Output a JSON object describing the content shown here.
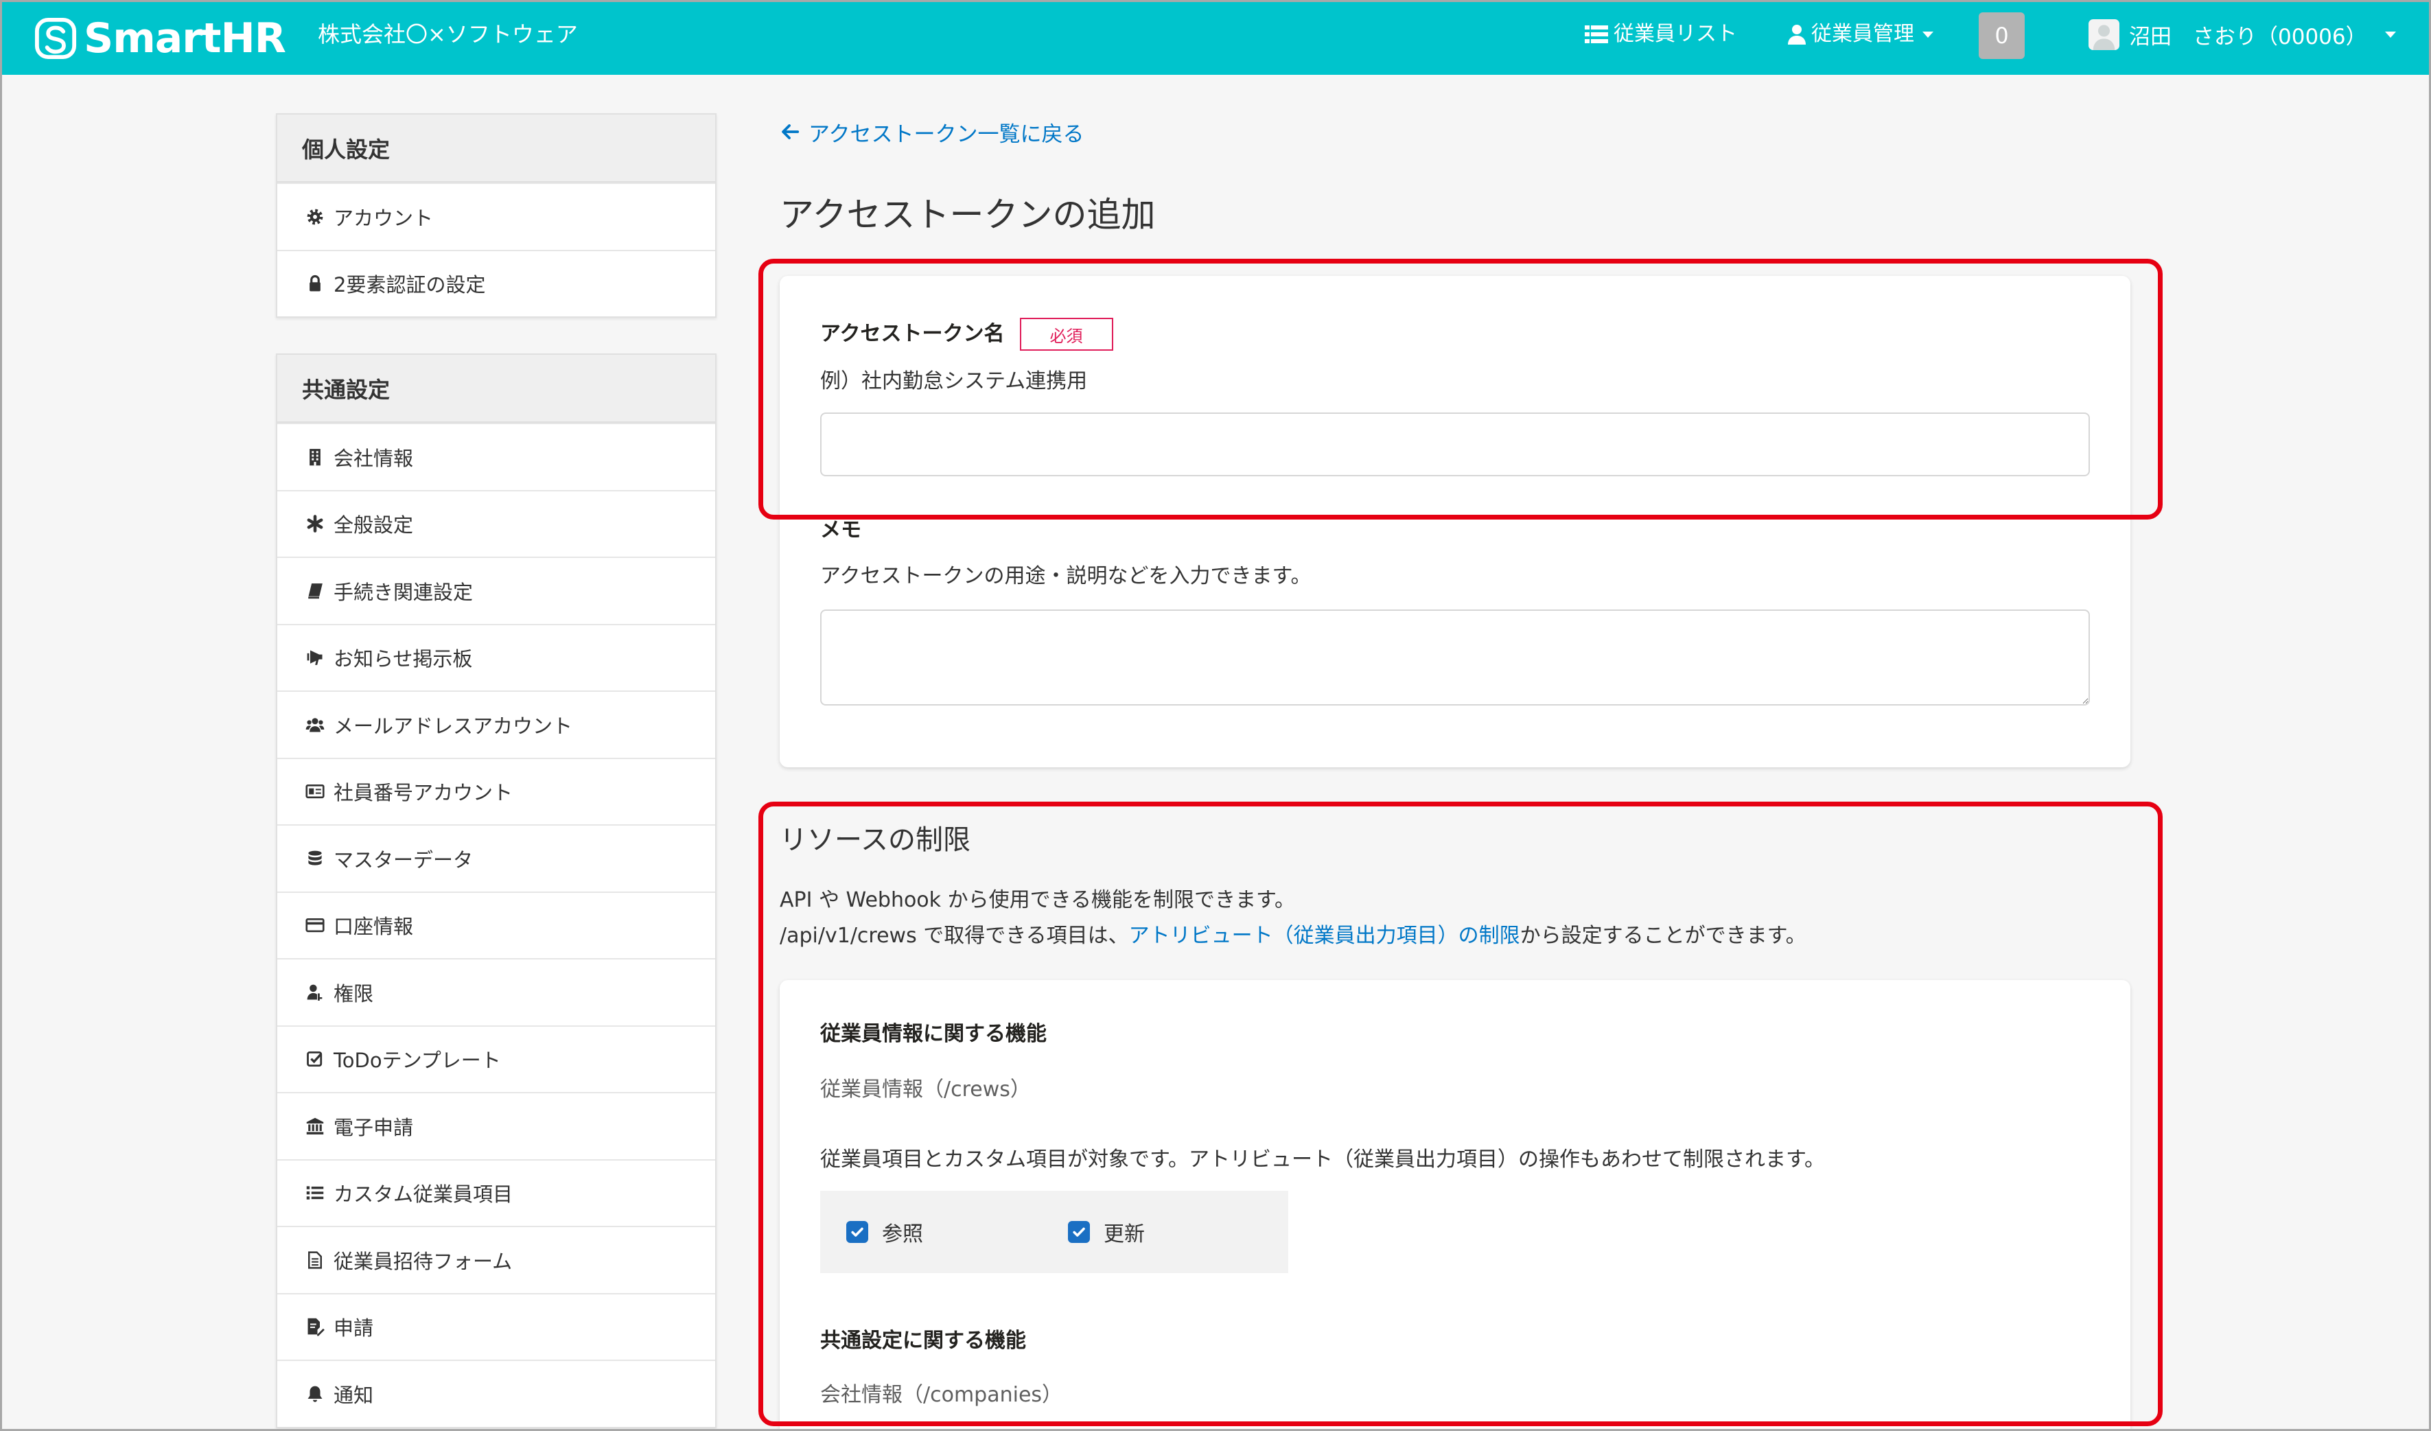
{
  "theme": {
    "header_bg": "#00c4cc",
    "link": "#0077c7",
    "required": "#e01e5a",
    "checkbox": "#1a6fc3",
    "highlight": "#e60012"
  },
  "header": {
    "logo": "SmartHR",
    "company_name": "株式会社〇×ソフトウェア",
    "employee_list": {
      "label": "従業員リスト",
      "icon": "list-icon"
    },
    "employee_management": {
      "label": "従業員管理",
      "icon": "user-icon"
    },
    "notification_count": "0",
    "user": {
      "name": "沼田　さおり（00006）",
      "icon": "avatar-icon"
    }
  },
  "sidebar": {
    "personal": {
      "title": "個人設定",
      "items": [
        {
          "label": "アカウント",
          "icon": "gear-icon"
        },
        {
          "label": "2要素認証の設定",
          "icon": "lock-icon"
        }
      ]
    },
    "common": {
      "title": "共通設定",
      "items": [
        {
          "label": "会社情報",
          "icon": "building-icon"
        },
        {
          "label": "全般設定",
          "icon": "asterisk-icon"
        },
        {
          "label": "手続き関連設定",
          "icon": "book-icon"
        },
        {
          "label": "お知らせ掲示板",
          "icon": "bullhorn-icon"
        },
        {
          "label": "メールアドレスアカウント",
          "icon": "users-icon"
        },
        {
          "label": "社員番号アカウント",
          "icon": "id-card-icon"
        },
        {
          "label": "マスターデータ",
          "icon": "database-icon"
        },
        {
          "label": "口座情報",
          "icon": "credit-card-icon"
        },
        {
          "label": "権限",
          "icon": "user-key-icon"
        },
        {
          "label": "ToDoテンプレート",
          "icon": "check-square-icon"
        },
        {
          "label": "電子申請",
          "icon": "bank-icon"
        },
        {
          "label": "カスタム従業員項目",
          "icon": "list-icon"
        },
        {
          "label": "従業員招待フォーム",
          "icon": "file-text-icon"
        },
        {
          "label": "申請",
          "icon": "file-signature-icon"
        },
        {
          "label": "通知",
          "icon": "bell-icon"
        }
      ]
    }
  },
  "main": {
    "back_link": "アクセストークン一覧に戻る",
    "page_title": "アクセストークンの追加",
    "token_form": {
      "name_label": "アクセストークン名",
      "required_badge": "必須",
      "name_hint": "例）社内勤怠システム連携用",
      "name_value": "",
      "memo_label": "メモ",
      "memo_hint": "アクセストークンの用途・説明などを入力できます。",
      "memo_value": ""
    },
    "resource_limits": {
      "title": "リソースの制限",
      "line1": "API や Webhook から使用できる機能を制限できます。",
      "line2_prefix": "/api/v1/crews で取得できる項目は、",
      "line2_link": "アトリビュート（従業員出力項目）の制限",
      "line2_suffix": "から設定することができます。",
      "groups": [
        {
          "title": "従業員情報に関する機能",
          "resource": "従業員情報（/crews）",
          "description": "従業員項目とカスタム項目が対象です。アトリビュート（従業員出力項目）の操作もあわせて制限されます。",
          "permissions": [
            {
              "label": "参照",
              "checked": true
            },
            {
              "label": "更新",
              "checked": true
            }
          ]
        },
        {
          "title": "共通設定に関する機能",
          "resource": "会社情報（/companies）"
        }
      ]
    }
  }
}
